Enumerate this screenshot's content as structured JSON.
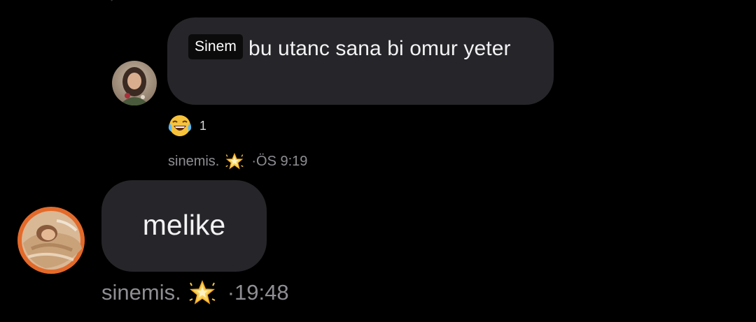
{
  "messages": [
    {
      "tag": "Sinem",
      "text": "bu utanc sana bi omur yeter",
      "reaction": {
        "emoji": "face-with-tears-of-joy",
        "count": "1"
      },
      "sender": "sinemis.",
      "sender_badge": "glowing-star-icon",
      "time": "·ÖS 9:19"
    },
    {
      "text": "melike",
      "sender": "sinemis.",
      "sender_badge": "glowing-star-icon",
      "time": "·19:48"
    }
  ],
  "colors": {
    "background": "#000000",
    "bubble": "#26262a",
    "meta_text": "#8e8e93",
    "tag_background": "#0b0b0c"
  }
}
